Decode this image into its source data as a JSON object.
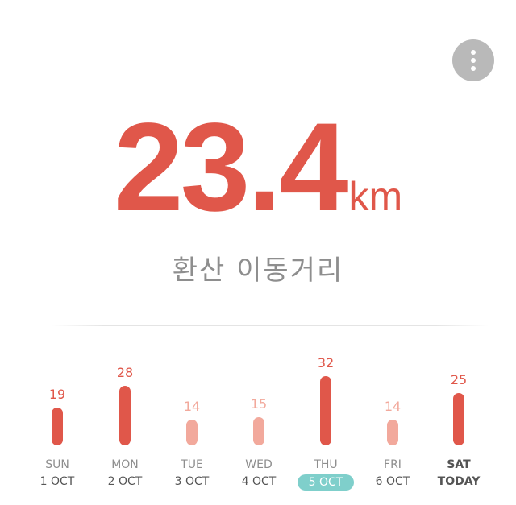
{
  "header": {
    "menu_icon": "more-vertical-icon"
  },
  "distance": {
    "value": "23.4",
    "unit": "km",
    "caption": "환산 이동거리"
  },
  "colors": {
    "accent": "#e0574a",
    "accent_light": "#f2a99c",
    "highlight": "#7fcfcb",
    "muted_text": "#8e8e8e"
  },
  "chart_data": {
    "type": "bar",
    "categories": [
      "SUN",
      "MON",
      "TUE",
      "WED",
      "THU",
      "FRI",
      "SAT"
    ],
    "dates": [
      "1 OCT",
      "2 OCT",
      "3 OCT",
      "4 OCT",
      "5 OCT",
      "6 OCT",
      "TODAY"
    ],
    "values": [
      19,
      28,
      14,
      15,
      32,
      14,
      25
    ],
    "highlight_threshold": 19,
    "selected_index": 4,
    "today_index": 6
  }
}
